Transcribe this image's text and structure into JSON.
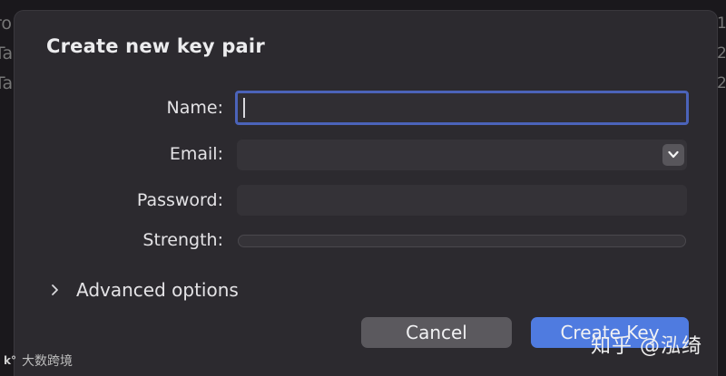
{
  "background": {
    "left_fragments": [
      "ro",
      "Ta",
      "Ta"
    ],
    "right_fragments": [
      "1",
      "2",
      "2"
    ]
  },
  "dialog": {
    "title": "Create new key pair",
    "fields": {
      "name": {
        "label": "Name:",
        "value": ""
      },
      "email": {
        "label": "Email:",
        "value": ""
      },
      "password": {
        "label": "Password:",
        "value": ""
      },
      "strength": {
        "label": "Strength:",
        "value": 0
      }
    },
    "advanced_label": "Advanced options",
    "buttons": {
      "cancel": "Cancel",
      "create": "Create Key"
    }
  },
  "watermarks": {
    "left_logo": "k°",
    "left_text": "大数跨境",
    "right_text": "知乎 @泓绮"
  },
  "colors": {
    "accent": "#4f7be0",
    "focus_ring": "#4b63b9",
    "dialog_bg": "#2c2a2f"
  }
}
